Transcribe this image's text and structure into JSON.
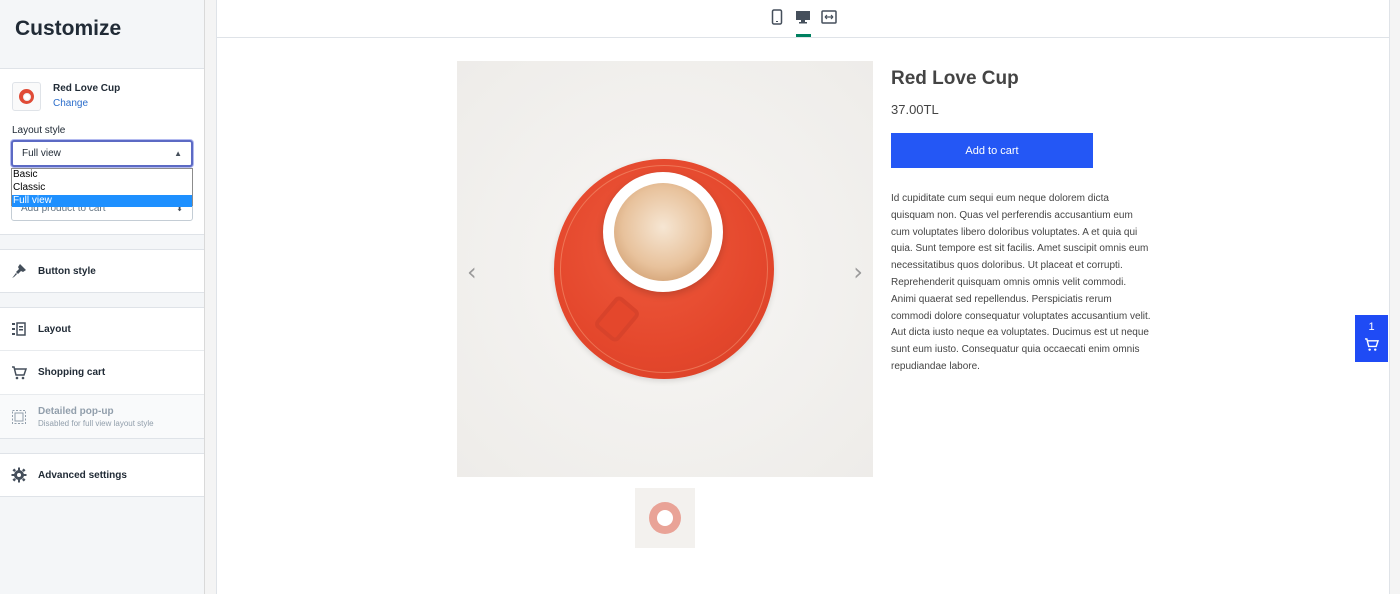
{
  "sidebar": {
    "title": "Customize",
    "product": {
      "name": "Red Love Cup",
      "change_label": "Change"
    },
    "layout_style": {
      "label": "Layout style",
      "selected": "Full view",
      "options": [
        "Basic",
        "Classic",
        "Full view"
      ]
    },
    "button_action": {
      "selected": "Add product to cart"
    },
    "items": [
      {
        "label": "Button style",
        "icon": "paint-brush-icon"
      },
      {
        "label": "Layout",
        "icon": "layout-icon"
      },
      {
        "label": "Shopping cart",
        "icon": "cart-icon"
      },
      {
        "label": "Detailed pop-up",
        "sublabel": "Disabled for full view layout style",
        "icon": "popup-icon",
        "disabled": true
      },
      {
        "label": "Advanced settings",
        "icon": "gear-icon"
      }
    ]
  },
  "preview": {
    "devices": [
      {
        "name": "mobile",
        "icon": "mobile-icon"
      },
      {
        "name": "desktop",
        "icon": "desktop-icon",
        "active": true
      },
      {
        "name": "fullwidth",
        "icon": "expand-icon"
      }
    ],
    "product": {
      "title": "Red Love Cup",
      "price": "37.00TL",
      "add_to_cart_label": "Add to cart",
      "description": "Id cupiditate cum sequi eum neque dolorem dicta quisquam non. Quas vel perferendis accusantium eum cum voluptates libero doloribus voluptates. A et quia qui quia. Sunt tempore est sit facilis. Amet suscipit omnis eum necessitatibus quos doloribus. Ut placeat et corrupti. Reprehenderit quisquam omnis omnis velit commodi. Animi quaerat sed repellendus. Perspiciatis rerum commodi dolore consequatur voluptates accusantium velit. Aut dicta iusto neque ea voluptates. Ducimus est ut neque sunt eum iusto. Consequatur quia occaecati enim omnis repudiandae labore."
    },
    "cart": {
      "count": "1"
    }
  },
  "colors": {
    "accent_blue": "#2457f5",
    "cart_blue": "#1f4bf5",
    "active_device": "#008060",
    "link": "#2c6ecb"
  }
}
